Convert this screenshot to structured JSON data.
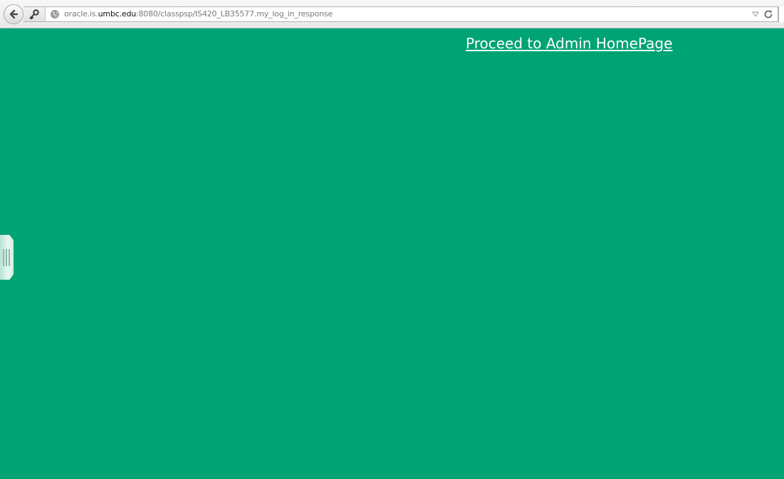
{
  "browser": {
    "url": {
      "subdomain": "oracle.is.",
      "domain": "umbc.edu",
      "rest": ":8080/classpsp/IS420_LB35577.my_log_in_response"
    },
    "icons": {
      "back": "back-arrow-icon",
      "identity": "key-icon",
      "site": "globe-icon",
      "dropmarker": "dropdown-triangle-icon",
      "reload": "reload-icon"
    }
  },
  "page": {
    "background_color": "#00a374",
    "link_color": "#ffffff",
    "proceed_link_label": "Proceed to Admin HomePage"
  },
  "sidebar_handle": {
    "icon": "grip-handle-icon"
  }
}
